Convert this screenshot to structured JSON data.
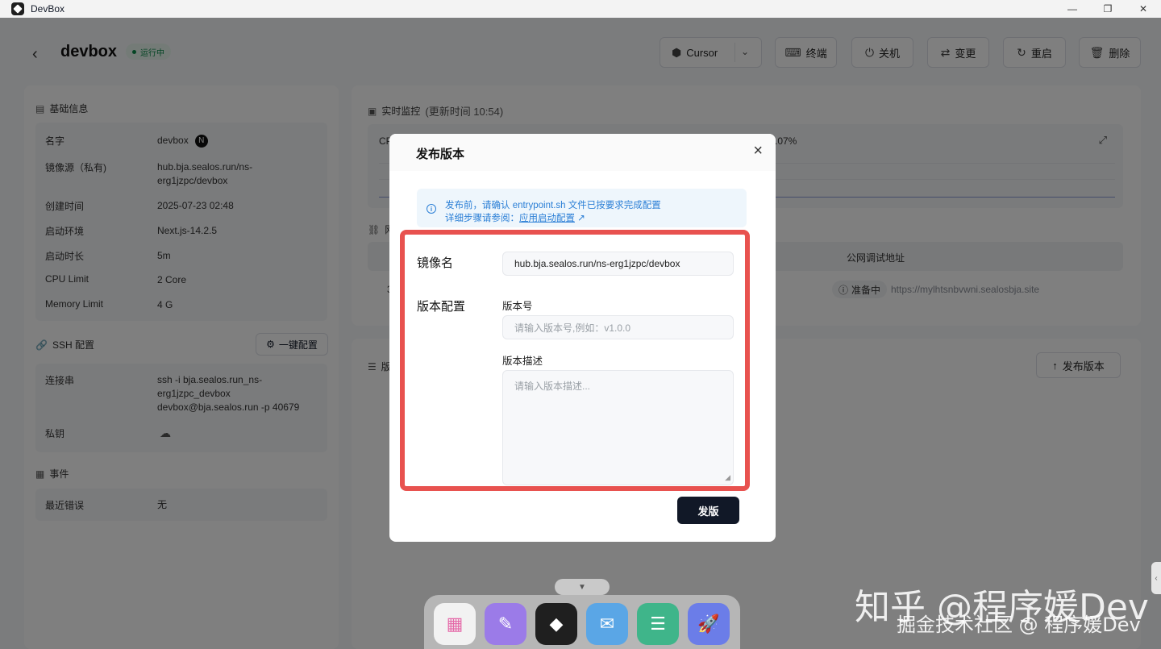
{
  "window": {
    "title": "DevBox",
    "minimize": "—",
    "maximize": "❐",
    "close": "✕"
  },
  "header": {
    "back": "‹",
    "name": "devbox",
    "status": "运行中",
    "buttons": {
      "ide": "Cursor",
      "terminal": "终端",
      "shutdown": "关机",
      "change": "变更",
      "restart": "重启",
      "delete": "删除"
    }
  },
  "basic_info": {
    "title": "基础信息",
    "rows": [
      {
        "key": "名字",
        "value": "devbox",
        "badge": "N"
      },
      {
        "key": "镜像源（私有)",
        "value": "hub.bja.sealos.run/ns-erg1jzpc/devbox"
      },
      {
        "key": "创建时间",
        "value": "2025-07-23 02:48"
      },
      {
        "key": "启动环境",
        "value": "Next.js-14.2.5"
      },
      {
        "key": "启动时长",
        "value": "5m"
      },
      {
        "key": "CPU Limit",
        "value": "2 Core"
      },
      {
        "key": "Memory Limit",
        "value": "4 G"
      }
    ]
  },
  "ssh": {
    "title": "SSH 配置",
    "config_button": "一键配置",
    "rows": [
      {
        "key": "连接串",
        "value": "ssh -i bja.sealos.run_ns-erg1jzpc_devbox devbox@bja.sealos.run -p 40679"
      },
      {
        "key": "私钥",
        "value": ""
      }
    ]
  },
  "events": {
    "title": "事件",
    "rows": [
      {
        "key": "最近错误",
        "value": "无"
      }
    ]
  },
  "monitor": {
    "title": "实时监控",
    "updated": "(更新时间  10:54)",
    "cpu_label": "CP",
    "cpu_value": ".07%"
  },
  "network": {
    "title_fragment": "网",
    "col_public": "公网调试地址",
    "row_fragment": "3",
    "status": "准备中",
    "public_url": "https://mylhtsnbvwni.sealosbja.site"
  },
  "versions": {
    "title_fragment": "版",
    "publish_button": "发布版本"
  },
  "dialog": {
    "title": "发布版本",
    "tip_line1": "发布前，请确认 entrypoint.sh 文件已按要求完成配置",
    "tip_line2_prefix": "详细步骤请参阅：",
    "tip_link": "应用启动配置",
    "image_label": "镜像名",
    "image_value": "hub.bja.sealos.run/ns-erg1jzpc/devbox",
    "version_config_label": "版本配置",
    "version_no_label": "版本号",
    "version_no_placeholder": "请输入版本号,例如：v1.0.0",
    "version_desc_label": "版本描述",
    "version_desc_placeholder": "请输入版本描述...",
    "submit": "发版"
  },
  "dock": {
    "apps": [
      "launchpad",
      "notes",
      "devbox",
      "message",
      "database",
      "rocket"
    ]
  },
  "watermark": {
    "line1": "知乎 @程序媛Dev",
    "line2": "掘金技术社区 @ 程序媛Dev"
  },
  "colors": {
    "accent_dark": "#111827",
    "highlight": "#e8524f",
    "info": "#2b7fd6",
    "running": "#0a8a49"
  }
}
